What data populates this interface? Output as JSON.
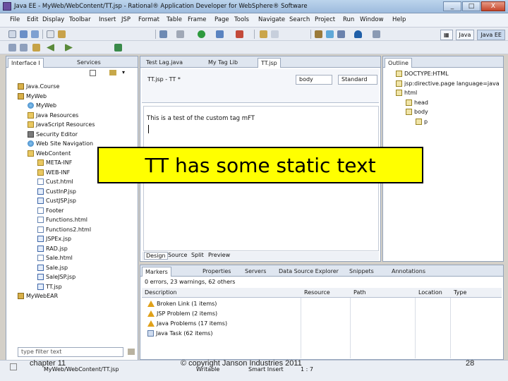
{
  "window": {
    "title": "Java EE - MyWeb/WebContent/TT.jsp - Rational® Application Developer for WebSphere® Software",
    "controls": [
      "_",
      "□",
      "X"
    ]
  },
  "menu": [
    "File",
    "Edit",
    "Display",
    "Toolbar",
    "Insert",
    "JSP",
    "Format",
    "Table",
    "Frame",
    "Page",
    "Tools",
    "Navigate",
    "Search",
    "Project",
    "Run",
    "Window",
    "Help"
  ],
  "perspective": {
    "java": "Java",
    "javaee": "Java EE"
  },
  "left_panel": {
    "tabs": [
      "Interface I",
      "Services"
    ],
    "tree": [
      {
        "label": "Java.Course",
        "indent": 0,
        "icon": "project-icon"
      },
      {
        "label": "MyWeb",
        "indent": 0,
        "icon": "project-icon"
      },
      {
        "label": "MyWeb",
        "indent": 1,
        "icon": "web-icon"
      },
      {
        "label": "Java Resources",
        "indent": 1,
        "icon": "folder-icon"
      },
      {
        "label": "JavaScript Resources",
        "indent": 1,
        "icon": "folder-icon"
      },
      {
        "label": "Security Editor",
        "indent": 1,
        "icon": "tool-icon"
      },
      {
        "label": "Web Site Navigation",
        "indent": 1,
        "icon": "web-icon"
      },
      {
        "label": "WebContent",
        "indent": 1,
        "icon": "folder-icon"
      },
      {
        "label": "META-INF",
        "indent": 2,
        "icon": "folder-icon"
      },
      {
        "label": "WEB-INF",
        "indent": 2,
        "icon": "folder-icon"
      },
      {
        "label": "Cust.html",
        "indent": 2,
        "icon": "file-icon"
      },
      {
        "label": "CustInP.jsp",
        "indent": 2,
        "icon": "jsp-icon"
      },
      {
        "label": "CustJSP.jsp",
        "indent": 2,
        "icon": "jsp-icon"
      },
      {
        "label": "Footer",
        "indent": 2,
        "icon": "file-icon"
      },
      {
        "label": "Functions.html",
        "indent": 2,
        "icon": "file-icon"
      },
      {
        "label": "Functions2.html",
        "indent": 2,
        "icon": "file-icon"
      },
      {
        "label": "JSPEx.jsp",
        "indent": 2,
        "icon": "jsp-icon"
      },
      {
        "label": "RAD.jsp",
        "indent": 2,
        "icon": "jsp-icon"
      },
      {
        "label": "Sale.html",
        "indent": 2,
        "icon": "file-icon"
      },
      {
        "label": "Sale.jsp",
        "indent": 2,
        "icon": "jsp-icon"
      },
      {
        "label": "SaleJSP.jsp",
        "indent": 2,
        "icon": "jsp-icon"
      },
      {
        "label": "TT.jsp",
        "indent": 2,
        "icon": "jsp-icon"
      },
      {
        "label": "MyWebEAR",
        "indent": 0,
        "icon": "project-icon"
      }
    ],
    "filter_placeholder": "type filter text"
  },
  "editor": {
    "tabs": [
      "Test Lag.java",
      "My Tag Lib",
      "TT.jsp"
    ],
    "breadcrumb": "TT.jsp - TT *",
    "body_select": "body",
    "mode_select": "Standard",
    "content": "This is a test of the custom tag mFT",
    "bottom_tabs": [
      "Design",
      "Source",
      "Split",
      "Preview"
    ]
  },
  "outline": {
    "tab": "Outline",
    "items": [
      {
        "label": "DOCTYPE:HTML",
        "indent": 0
      },
      {
        "label": "jsp:directive.page language=java",
        "indent": 0
      },
      {
        "label": "html",
        "indent": 0
      },
      {
        "label": "head",
        "indent": 1
      },
      {
        "label": "body",
        "indent": 1
      },
      {
        "label": "p",
        "indent": 2
      }
    ]
  },
  "markers": {
    "tabs": [
      "Markers",
      "Properties",
      "Servers",
      "Data Source Explorer",
      "Snippets",
      "Annotations"
    ],
    "summary": "0 errors, 23 warnings, 62 others",
    "columns": [
      "Description",
      "Resource",
      "Path",
      "Location",
      "Type"
    ],
    "rows": [
      {
        "label": "Broken Link (1 items)",
        "icon": "warn-icon"
      },
      {
        "label": "JSP Problem (2 items)",
        "icon": "warn-icon"
      },
      {
        "label": "Java Problems (17 items)",
        "icon": "warn-icon"
      },
      {
        "label": "Java Task (62 items)",
        "icon": "task-icon"
      }
    ]
  },
  "overlay": {
    "text": "TT has some static text"
  },
  "status": {
    "path": "MyWeb/WebContent/TT.jsp",
    "writable": "Writable",
    "insert": "Smart Insert",
    "position": "1 : 7"
  },
  "footer": {
    "left": "chapter 11",
    "center": "© copyright Janson Industries 2011",
    "page": "28"
  }
}
